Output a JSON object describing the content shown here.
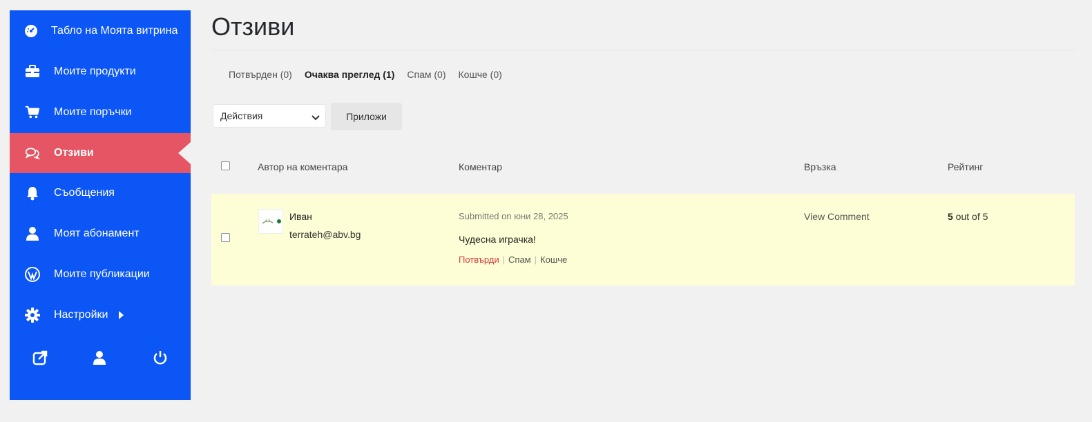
{
  "sidebar": {
    "items": [
      {
        "label": "Табло на Моята витрина",
        "icon": "dashboard-icon"
      },
      {
        "label": "Моите продукти",
        "icon": "briefcase-icon"
      },
      {
        "label": "Моите поръчки",
        "icon": "cart-icon"
      },
      {
        "label": "Отзиви",
        "icon": "comments-icon",
        "active": true
      },
      {
        "label": "Съобщения",
        "icon": "bell-icon"
      },
      {
        "label": "Моят абонамент",
        "icon": "user-icon"
      },
      {
        "label": "Моите публикации",
        "icon": "wordpress-icon"
      },
      {
        "label": "Настройки",
        "icon": "gear-icon"
      }
    ],
    "bottom_icons": [
      "external-link-icon",
      "user-icon",
      "power-icon"
    ]
  },
  "page": {
    "title": "Отзиви"
  },
  "status_tabs": [
    {
      "label": "Потвърден (0)"
    },
    {
      "label": "Очаква преглед (1)",
      "current": true
    },
    {
      "label": "Спам (0)"
    },
    {
      "label": "Кошче (0)"
    }
  ],
  "bulk": {
    "select_value": "Действия",
    "apply_label": "Приложи"
  },
  "table": {
    "columns": [
      "Автор на коментара",
      "Коментар",
      "Връзка",
      "Рейтинг"
    ],
    "rows": [
      {
        "author_name": "Иван",
        "author_email": "terrateh@abv.bg",
        "submitted": "Submitted on юни 28, 2025",
        "comment": "Чудесна играчка!",
        "actions": {
          "approve": "Потвърди",
          "spam": "Спам",
          "trash": "Кошче"
        },
        "link": "View Comment",
        "rating_value": "5",
        "rating_suffix": " out of 5"
      }
    ]
  },
  "colors": {
    "sidebar": "#0b56f5",
    "active_item": "#e55563",
    "row_highlight": "#fefed6",
    "approve": "#d63638"
  }
}
